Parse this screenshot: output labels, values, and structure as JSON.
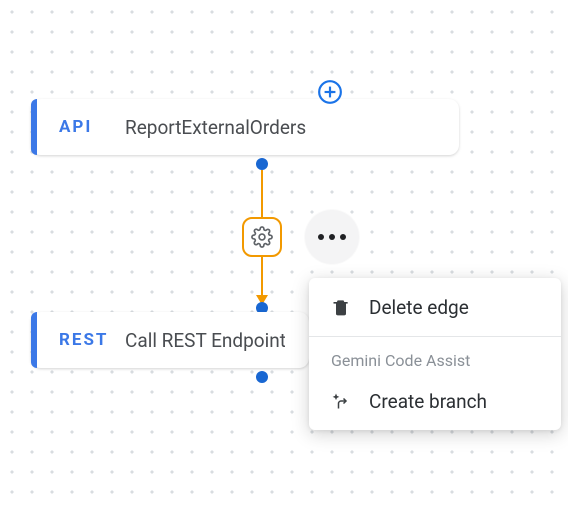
{
  "nodes": {
    "api": {
      "tag": "API",
      "label": "ReportExternalOrders"
    },
    "rest": {
      "tag": "REST",
      "label": "Call REST Endpoint"
    }
  },
  "menu": {
    "delete": "Delete edge",
    "section": "Gemini Code Assist",
    "create_branch": "Create branch"
  },
  "icons": {
    "add": "plus-circle-icon",
    "gear": "gear-icon",
    "more": "more-icon",
    "trash": "trash-icon",
    "branch": "sparkle-branch-icon"
  },
  "colors": {
    "accent": "#3b78e7",
    "edge": "#f29900",
    "dot": "#1967d2"
  }
}
